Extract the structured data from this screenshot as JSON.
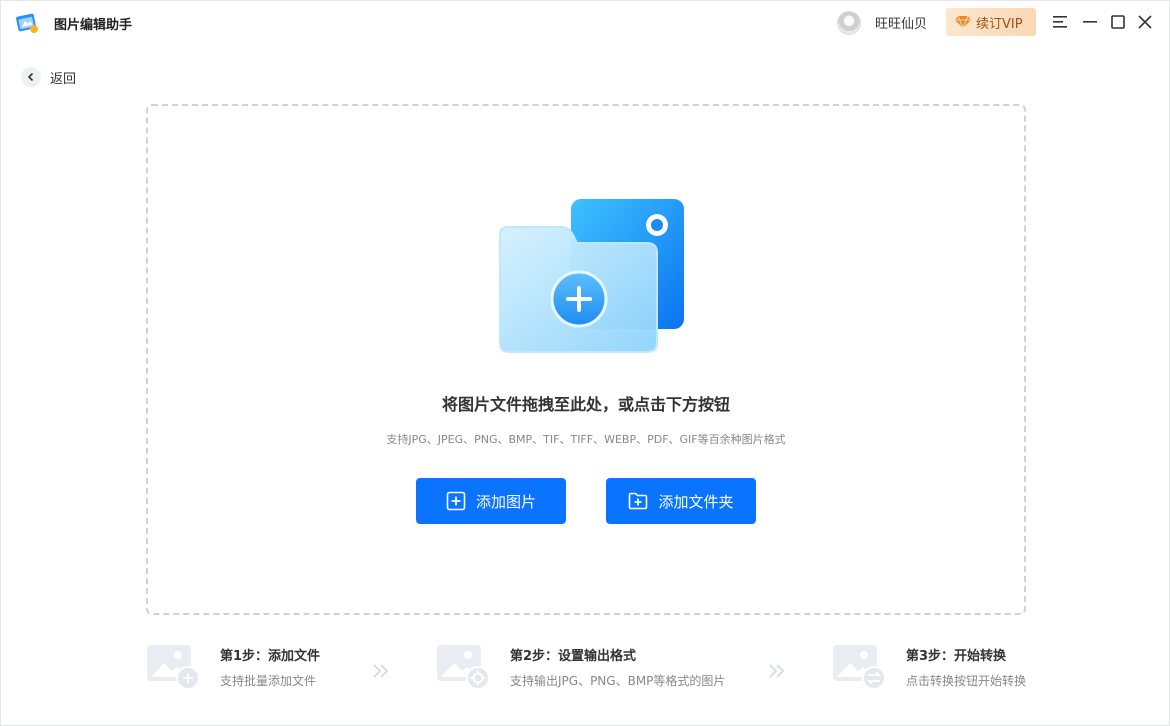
{
  "app": {
    "title": "图片编辑助手"
  },
  "header": {
    "user_name": "旺旺仙贝",
    "vip_label": "续订VIP",
    "icons": [
      "menu-icon",
      "minimize-icon",
      "maximize-icon",
      "close-icon"
    ]
  },
  "nav": {
    "back_label": "返回"
  },
  "dropzone": {
    "title": "将图片文件拖拽至此处，或点击下方按钮",
    "subtitle": "支持JPG、JPEG、PNG、BMP、TIF、TIFF、WEBP、PDF、GIF等百余种图片格式",
    "add_image_label": "添加图片",
    "add_folder_label": "添加文件夹"
  },
  "steps": [
    {
      "title": "第1步：添加文件",
      "desc": "支持批量添加文件"
    },
    {
      "title": "第2步：设置输出格式",
      "desc": "支持输出JPG、PNG、BMP等格式的图片"
    },
    {
      "title": "第3步：开始转换",
      "desc": "点击转换按钮开始转换"
    }
  ],
  "colors": {
    "primary": "#0a73ff",
    "vip_bg": "#fde3c8",
    "vip_text": "#a0521a"
  }
}
